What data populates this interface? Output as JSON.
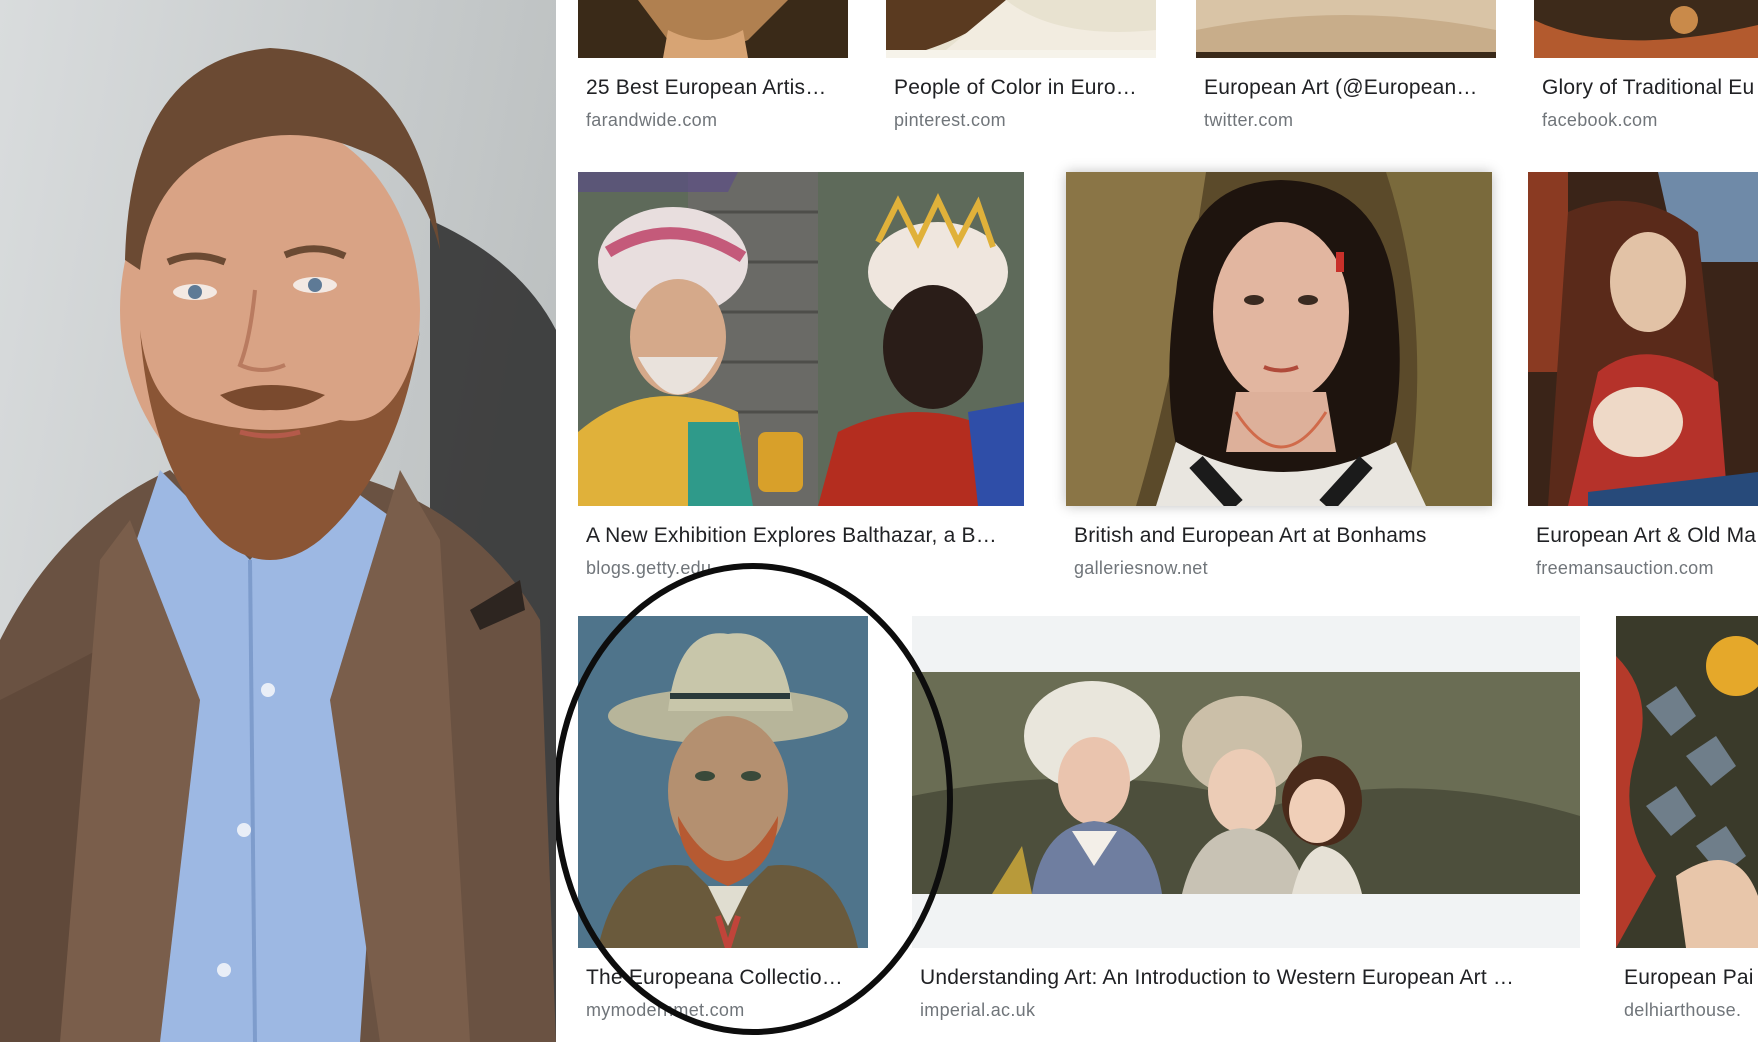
{
  "results": {
    "row1": [
      {
        "title": "25 Best European Artis…",
        "source": "farandwide.com"
      },
      {
        "title": "People of Color in Euro…",
        "source": "pinterest.com"
      },
      {
        "title": "European Art (@European…",
        "source": "twitter.com"
      },
      {
        "title": "Glory of Traditional Eu",
        "source": "facebook.com"
      }
    ],
    "row2": [
      {
        "title": "A New Exhibition Explores Balthazar, a B…",
        "source": "blogs.getty.edu"
      },
      {
        "title": "British and European Art at Bonhams",
        "source": "galleriesnow.net"
      },
      {
        "title": "European Art & Old Ma",
        "source": "freemansauction.com"
      }
    ],
    "row3": [
      {
        "title": "The Europeana Collectio…",
        "source": "mymodernmet.com"
      },
      {
        "title": "Understanding Art: An Introduction to Western European Art …",
        "source": "imperial.ac.uk"
      },
      {
        "title": "European Pai",
        "source": "delhiarthouse."
      }
    ]
  },
  "colors": {
    "title_text": "#202124",
    "source_text": "#70757a",
    "highlight_circle": "#0d0d0d",
    "placeholder_bg": "#f1f3f4"
  },
  "icons": [
    "man-portrait-photo",
    "highlight-circle"
  ]
}
